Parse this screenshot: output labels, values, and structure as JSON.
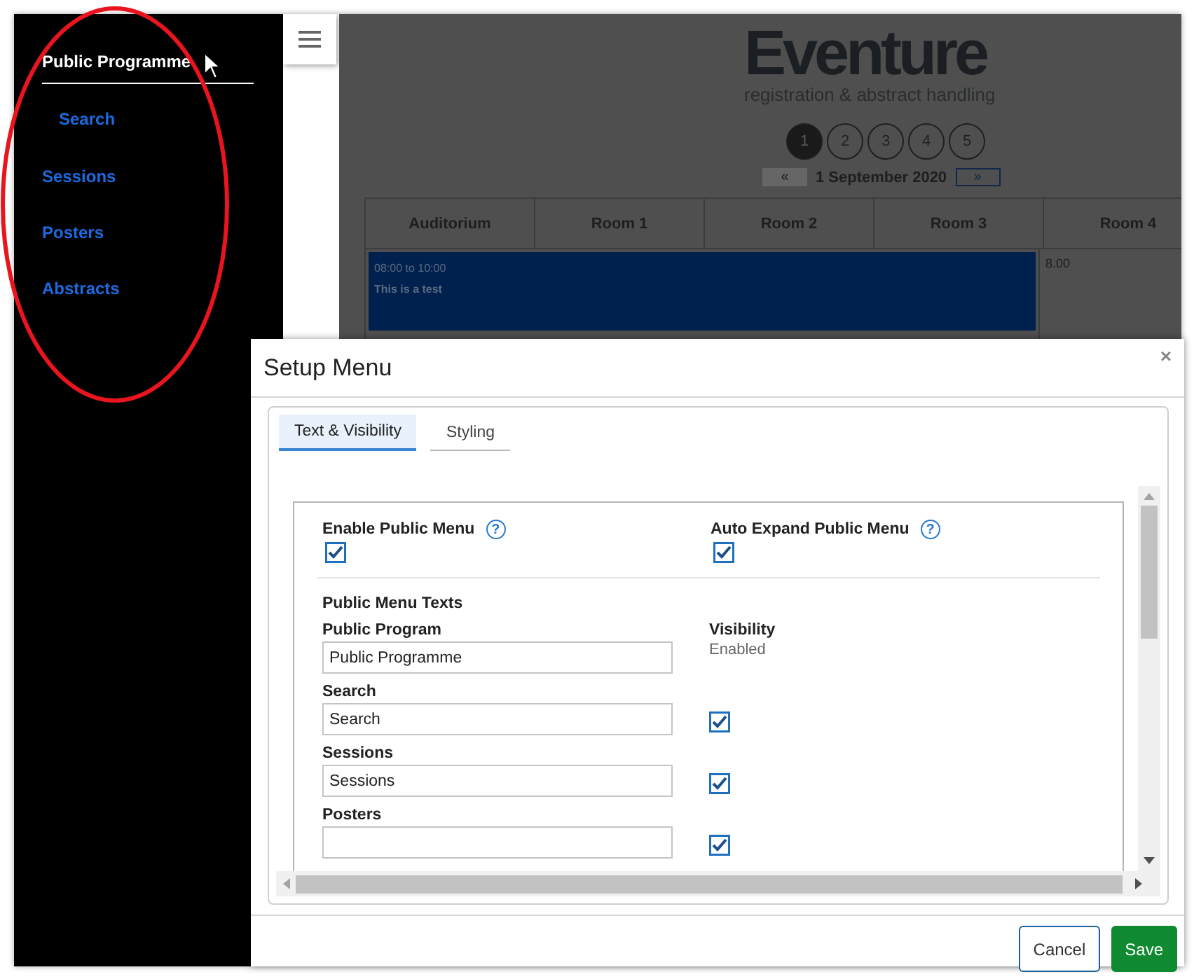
{
  "sidebar": {
    "items": [
      {
        "label": "Public Programme",
        "kind": "heading",
        "selected": true
      },
      {
        "label": "Search",
        "kind": "sub",
        "selected": false
      },
      {
        "label": "Sessions",
        "kind": "item",
        "selected": false
      },
      {
        "label": "Posters",
        "kind": "item",
        "selected": false
      },
      {
        "label": "Abstracts",
        "kind": "item",
        "selected": false
      }
    ]
  },
  "logo": {
    "title": "Eventure",
    "subtitle": "registration & abstract handling"
  },
  "pager": [
    {
      "label": "1",
      "selected": true
    },
    {
      "label": "2",
      "selected": false
    },
    {
      "label": "3",
      "selected": false
    },
    {
      "label": "4",
      "selected": false
    },
    {
      "label": "5",
      "selected": false
    }
  ],
  "date_nav": {
    "prev": "«",
    "date": "1 September 2020",
    "next": "»"
  },
  "table": {
    "columns": [
      "Auditorium",
      "Room 1",
      "Room 2",
      "Room 3",
      "Room 4"
    ],
    "event": {
      "time": "08:00 to 10:00",
      "title": "This is a test"
    },
    "cell": "8.00"
  },
  "modal": {
    "title": "Setup Menu",
    "close": "×",
    "tabs": [
      {
        "label": "Text & Visibility",
        "selected": true
      },
      {
        "label": "Styling",
        "selected": false
      }
    ],
    "toggles": [
      {
        "label": "Enable Public Menu",
        "help": "?",
        "checked": true
      },
      {
        "label": "Auto Expand Public Menu",
        "help": "?",
        "checked": true
      }
    ],
    "section_title": "Public Menu Texts",
    "fields": [
      {
        "label": "Public Program",
        "value": "Public Programme",
        "kind": "status",
        "status_label": "Visibility",
        "status": "Enabled"
      },
      {
        "label": "Search",
        "value": "Search",
        "kind": "check",
        "checked": true
      },
      {
        "label": "Sessions",
        "value": "Sessions",
        "kind": "check",
        "checked": true
      },
      {
        "label": "Posters",
        "kind": "check",
        "checked": true
      }
    ],
    "buttons": [
      {
        "label": "Cancel",
        "kind": "secondary"
      },
      {
        "label": "Save",
        "kind": "primary"
      }
    ]
  }
}
